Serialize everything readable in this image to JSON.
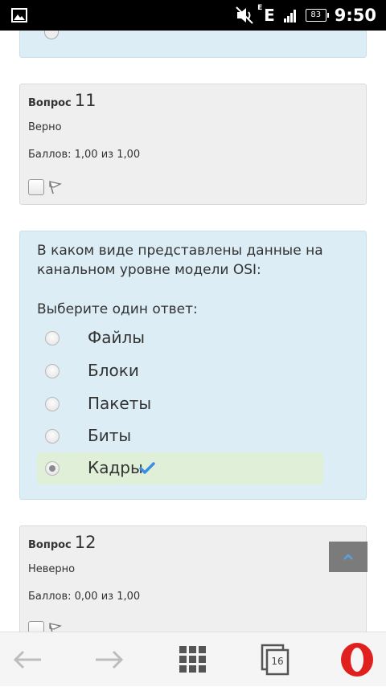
{
  "status_bar": {
    "time": "9:50",
    "battery": "83",
    "network": "E",
    "network_sup": "E"
  },
  "question_11": {
    "label": "Вопрос",
    "number": "11",
    "state": "Верно",
    "grade": "Баллов: 1,00 из 1,00"
  },
  "current_question": {
    "text": "В каком виде представлены данные на канальном уровне модели OSI:",
    "prompt": "Выберите один ответ:",
    "options": [
      {
        "label": "Файлы",
        "selected": false
      },
      {
        "label": "Блоки",
        "selected": false
      },
      {
        "label": "Пакеты",
        "selected": false
      },
      {
        "label": "Биты",
        "selected": false
      },
      {
        "label": "Кадры",
        "selected": true
      }
    ]
  },
  "question_12": {
    "label": "Вопрос",
    "number": "12",
    "state": "Неверно",
    "grade": "Баллов: 0,00 из 1,00"
  },
  "browser": {
    "tab_count": "16"
  },
  "colors": {
    "question_bg": "#dcedf5",
    "info_bg": "#efefef",
    "correct_bg": "#e0f0d8",
    "check": "#3a8ee6",
    "opera_red": "#e0201e"
  },
  "icons": [
    "image-icon",
    "mute-icon",
    "signal-icon",
    "battery-icon",
    "flag-icon",
    "check-icon",
    "chevron-up-icon",
    "back-arrow-icon",
    "forward-arrow-icon",
    "speed-dial-icon",
    "tabs-icon",
    "opera-logo-icon"
  ]
}
